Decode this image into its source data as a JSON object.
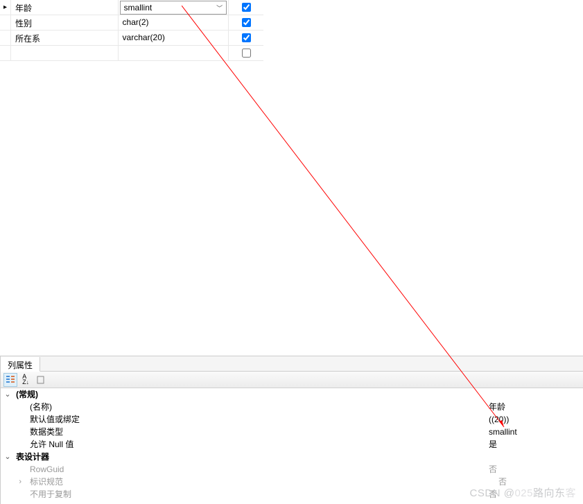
{
  "columns": [
    {
      "name": "年龄",
      "type": "smallint",
      "nullable": true,
      "selected": true
    },
    {
      "name": "性别",
      "type": "char(2)",
      "nullable": true,
      "selected": false
    },
    {
      "name": "所在系",
      "type": "varchar(20)",
      "nullable": true,
      "selected": false
    },
    {
      "name": "",
      "type": "",
      "nullable": false,
      "selected": false
    }
  ],
  "panel": {
    "tab_label": "列属性",
    "groups": {
      "general": {
        "title": "(常规)",
        "name_label": "(名称)",
        "name_value": "年龄",
        "default_label": "默认值或绑定",
        "default_value": "((20))",
        "datatype_label": "数据类型",
        "datatype_value": "smallint",
        "null_label": "允许 Null 值",
        "null_value": "是"
      },
      "designer": {
        "title": "表设计器",
        "rowguid_label": "RowGuid",
        "rowguid_value": "否",
        "identity_label": "标识规范",
        "identity_value": "否",
        "replication_label": "不用于复制",
        "replication_value": "否"
      }
    }
  },
  "watermark": {
    "prefix": "CSDN @",
    "overlap": "025",
    "suffix": "路向东"
  }
}
